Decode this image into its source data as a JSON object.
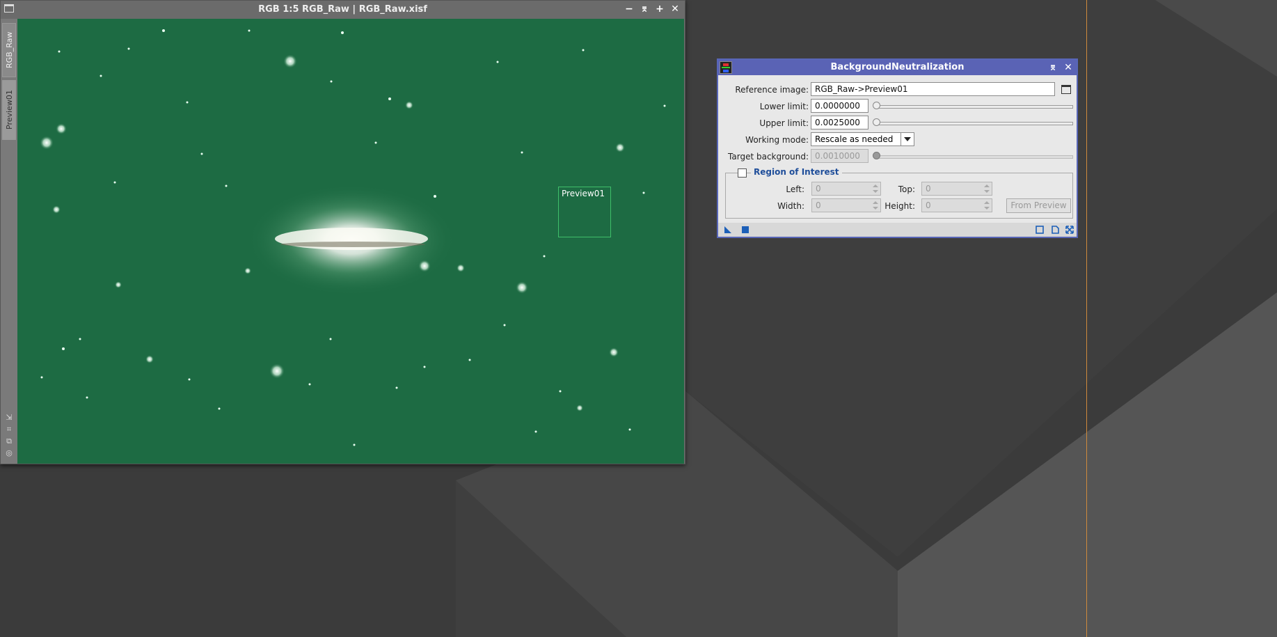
{
  "image_window": {
    "title": "RGB 1:5 RGB_Raw | RGB_Raw.xisf",
    "vertical_tabs": [
      "RGB_Raw",
      "Preview01"
    ],
    "preview_label": "Preview01",
    "buttons": [
      "−",
      "⌆",
      "+",
      "✕"
    ]
  },
  "dialog": {
    "title": "BackgroundNeutralization",
    "buttons": [
      "⌆",
      "✕"
    ],
    "reference_image": {
      "label": "Reference image:",
      "value": "RGB_Raw->Preview01"
    },
    "lower_limit": {
      "label": "Lower limit:",
      "value": "0.0000000"
    },
    "upper_limit": {
      "label": "Upper limit:",
      "value": "0.0025000"
    },
    "working_mode": {
      "label": "Working mode:",
      "value": "Rescale as needed"
    },
    "target_background": {
      "label": "Target background:",
      "value": "0.0010000"
    },
    "roi": {
      "title": "Region of Interest",
      "left": {
        "label": "Left:",
        "value": "0"
      },
      "top": {
        "label": "Top:",
        "value": "0"
      },
      "width": {
        "label": "Width:",
        "value": "0"
      },
      "height": {
        "label": "Height:",
        "value": "0"
      },
      "from_preview": "From Preview"
    }
  },
  "colors": {
    "dialog_accent": "#5a63b5",
    "image_background": "#1d6b43",
    "roi_title": "#1f4e9a"
  }
}
